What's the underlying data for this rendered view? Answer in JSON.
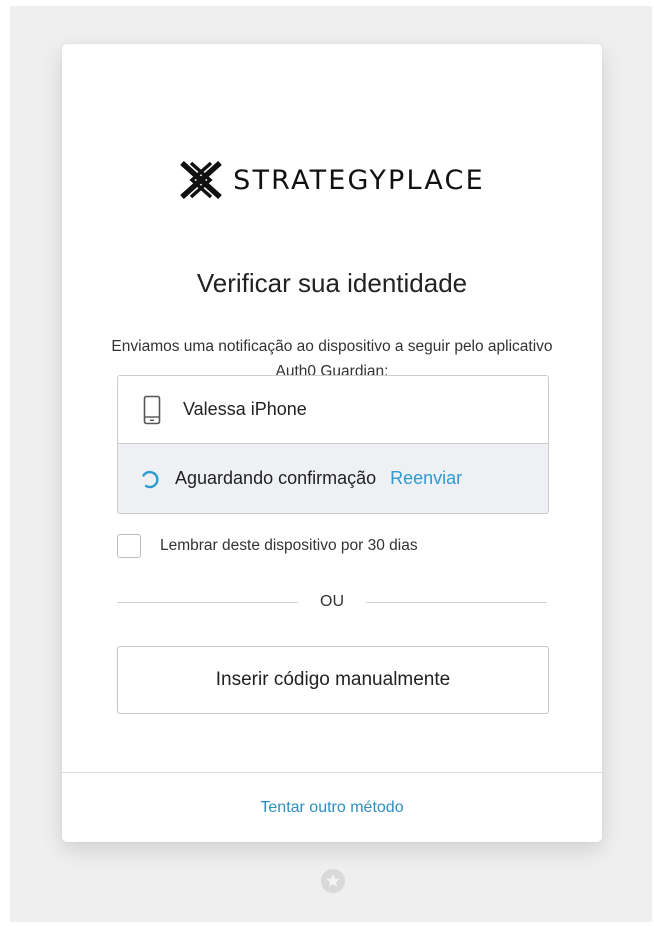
{
  "brand": {
    "logo_text": "STRATEGYPLACE"
  },
  "header": {
    "title": "Verificar sua identidade",
    "description": "Enviamos uma notificação ao dispositivo a seguir pelo aplicativo Auth0 Guardian:"
  },
  "device": {
    "icon": "mobile-phone-icon",
    "name": "Valessa iPhone",
    "status_icon": "spinner-icon",
    "status_text": "Aguardando confirmação",
    "resend_label": "Reenviar"
  },
  "remember": {
    "label": "Lembrar deste dispositivo por 30 dias",
    "checked": false
  },
  "divider": {
    "label": "OU"
  },
  "actions": {
    "manual_code_label": "Inserir código manualmente"
  },
  "footer": {
    "alt_method_label": "Tentar outro método",
    "badge_icon": "shield-star-icon"
  },
  "colors": {
    "link": "#2d9ad2",
    "status_bg": "#eef0f3",
    "page_bg": "#efefef"
  }
}
